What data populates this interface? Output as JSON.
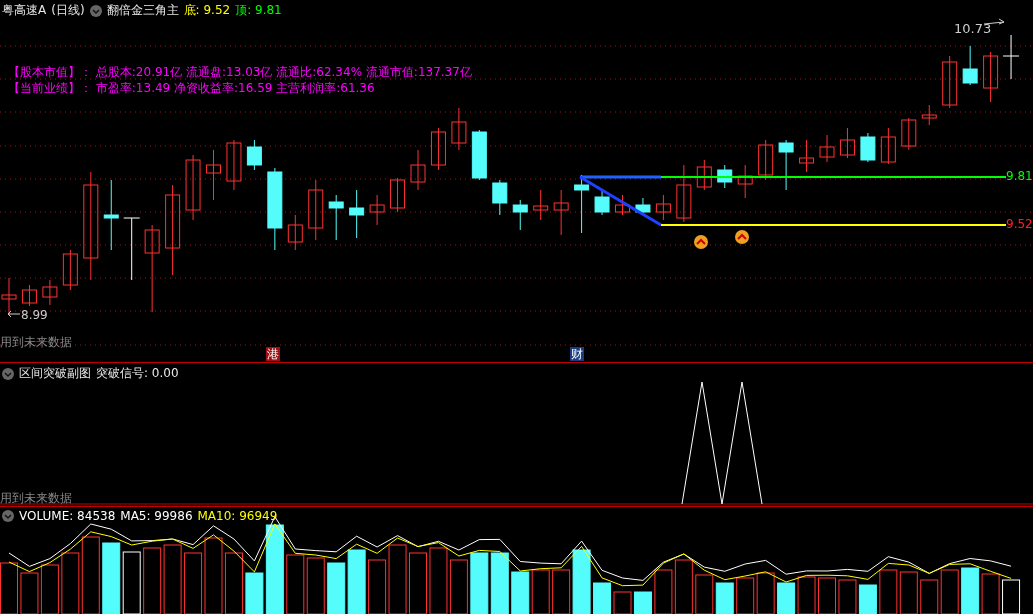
{
  "header": {
    "symbol": "粤高速A",
    "period": "(日线)",
    "indicator": "翻倍金三角主",
    "values": [
      {
        "label": "底:",
        "value": "9.52",
        "kind": "bottom"
      },
      {
        "label": "顶:",
        "value": "9.81",
        "kind": "top"
      }
    ]
  },
  "info_lines": [
    "【股本市值】： 总股本:20.91亿 流通盘:13.03亿 流通比:62.34% 流通市值:137.37亿",
    "【当前业绩】： 市盈率:13.49 净资收益率:16.59 主营利润率:61.36"
  ],
  "price_marks": [
    {
      "value": "10.73",
      "kind": "high"
    },
    {
      "value": "8.99",
      "kind": "low"
    }
  ],
  "levels": [
    {
      "value": "9.81",
      "kind": "top"
    },
    {
      "value": "9.52",
      "kind": "bottom"
    }
  ],
  "main_note": "用到未来数据",
  "event_tags": [
    {
      "text": "港",
      "kind": "hk"
    },
    {
      "text": "财",
      "kind": "finance"
    }
  ],
  "sub_panel": {
    "title": "区间突破副图",
    "reading": "突破信号: 0.00",
    "note": "用到未来数据"
  },
  "volume_panel": {
    "readings": [
      {
        "text": "VOLUME: 84538",
        "kind": "volume"
      },
      {
        "text": "MA5: 99986",
        "kind": "ma5"
      },
      {
        "text": "MA10: 96949",
        "kind": "ma10"
      }
    ]
  }
}
